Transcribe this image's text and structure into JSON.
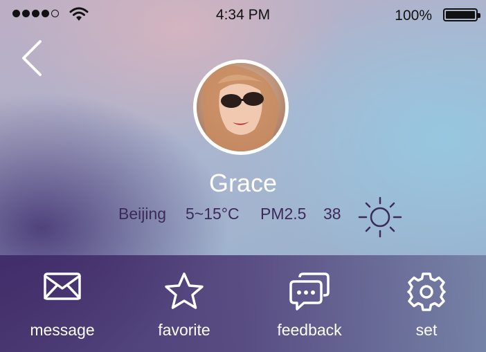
{
  "status_bar": {
    "signal_bars": 4,
    "signal_total": 5,
    "time": "4:34 PM",
    "battery": "100%"
  },
  "profile": {
    "name": "Grace"
  },
  "weather": {
    "city": "Beijing",
    "temperature": "5~15°C",
    "pm_label": "PM2.5",
    "pm_value": "38",
    "icon": "sun-icon"
  },
  "actions": [
    {
      "label": "message",
      "icon": "mail-icon"
    },
    {
      "label": "favorite",
      "icon": "star-icon"
    },
    {
      "label": "feedback",
      "icon": "chat-bubbles-icon"
    },
    {
      "label": "set",
      "icon": "gear-icon"
    }
  ],
  "colors": {
    "text_dark": "#3b2a5a",
    "white": "#ffffff",
    "bottom_bar": "#3c2664"
  }
}
